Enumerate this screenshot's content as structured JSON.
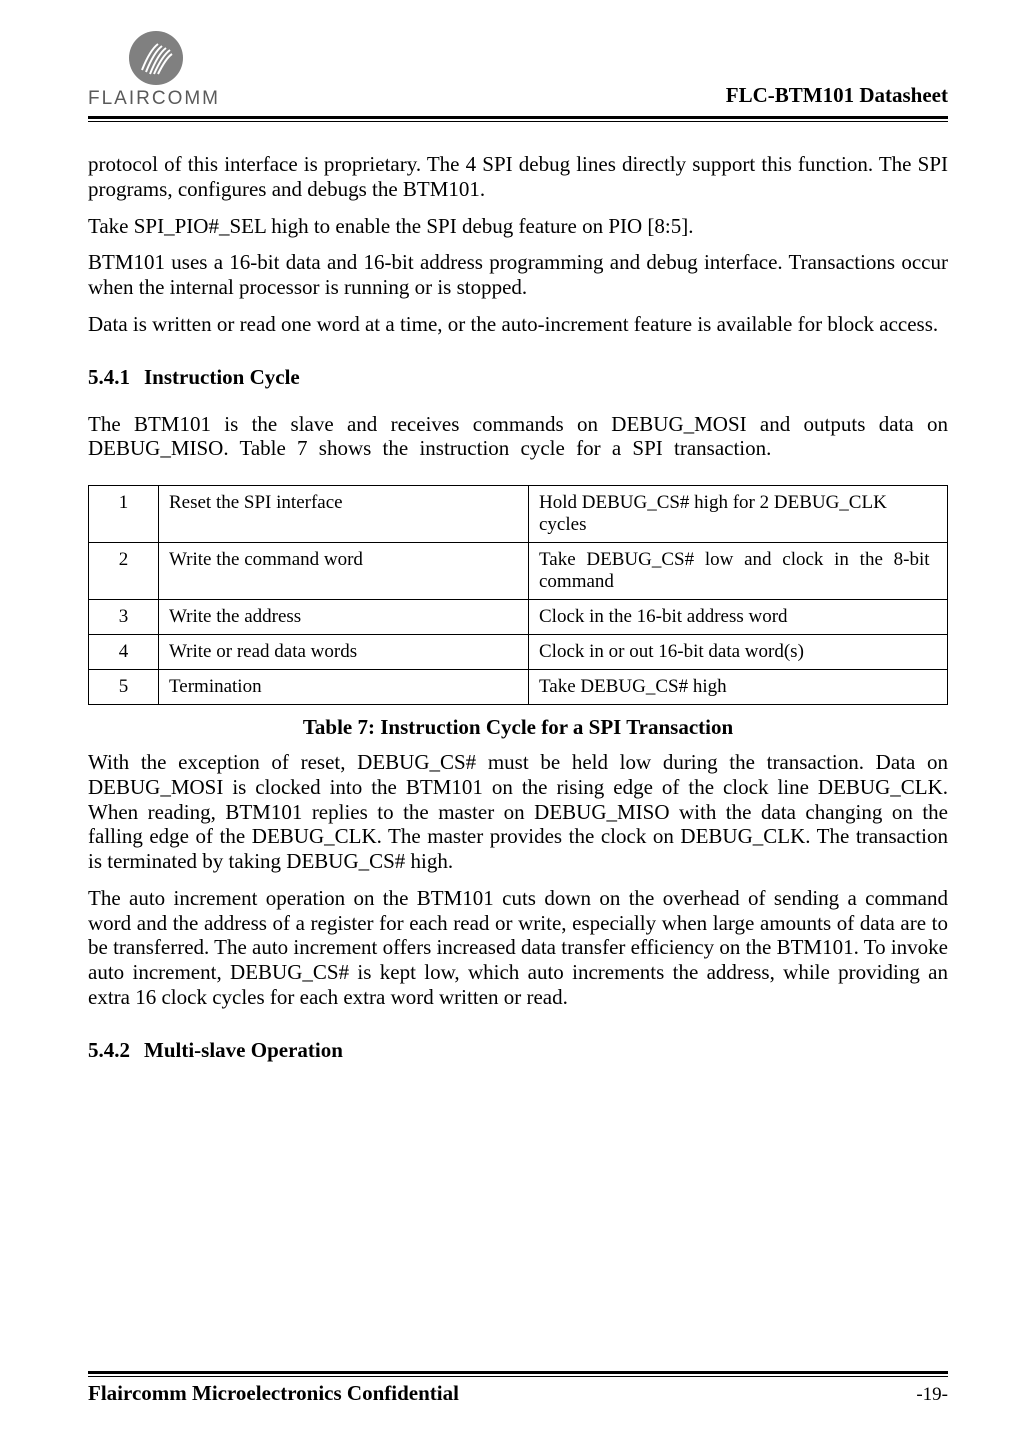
{
  "header": {
    "logo_text": "FLAIRCOMM",
    "doc_title": "FLC-BTM101 Datasheet"
  },
  "paras": {
    "p1": "protocol of this interface is proprietary. The 4 SPI debug lines directly support this function.  The SPI programs, configures and debugs the BTM101.",
    "p2": "Take SPI_PIO#_SEL high to enable the SPI debug feature on PIO [8:5].",
    "p3": "BTM101 uses a 16-bit data and 16-bit address programming and debug interface. Transactions occur when the internal processor is running or is stopped.",
    "p4": "Data is written or read one word at a time, or the auto-increment feature is available for block access."
  },
  "sec541": {
    "num": "5.4.1",
    "title": "Instruction Cycle",
    "intro": "The BTM101 is the slave and receives commands on DEBUG_MOSI and outputs data on DEBUG_MISO. Table 7 shows the instruction cycle for a SPI transaction."
  },
  "table7": {
    "caption": "Table 7: Instruction Cycle for a SPI Transaction",
    "rows": [
      {
        "n": "1",
        "step": "Reset the SPI interface",
        "action": "Hold DEBUG_CS# high for 2 DEBUG_CLK cycles"
      },
      {
        "n": "2",
        "step": "Write the command word",
        "action": "Take DEBUG_CS# low and clock in the 8-bit command"
      },
      {
        "n": "3",
        "step": "Write the address",
        "action": "Clock in the 16-bit address word"
      },
      {
        "n": "4",
        "step": "Write or read data words",
        "action": "Clock in or out 16-bit data word(s)"
      },
      {
        "n": "5",
        "step": "Termination",
        "action": "Take DEBUG_CS# high"
      }
    ]
  },
  "after_table": {
    "p1": "With the exception of reset, DEBUG_CS# must be held low during the transaction. Data on DEBUG_MOSI is clocked into the BTM101 on the rising edge of the clock line DEBUG_CLK. When reading, BTM101 replies to the master on DEBUG_MISO with the data changing on the falling edge of the DEBUG_CLK. The master provides the clock on DEBUG_CLK. The transaction is terminated by taking DEBUG_CS# high.",
    "p2": "The auto increment operation on the BTM101 cuts down on the overhead of sending a command word and the address of a register for each read or write, especially when large amounts of data are to be transferred. The auto increment offers increased data transfer efficiency on the BTM101. To invoke auto increment, DEBUG_CS# is kept low, which auto increments the address, while providing an extra 16 clock cycles for each extra word written or read."
  },
  "sec542": {
    "num": "5.4.2",
    "title": "Multi-slave Operation"
  },
  "footer": {
    "left": "Flaircomm Microelectronics Confidential",
    "right": "-19-"
  }
}
